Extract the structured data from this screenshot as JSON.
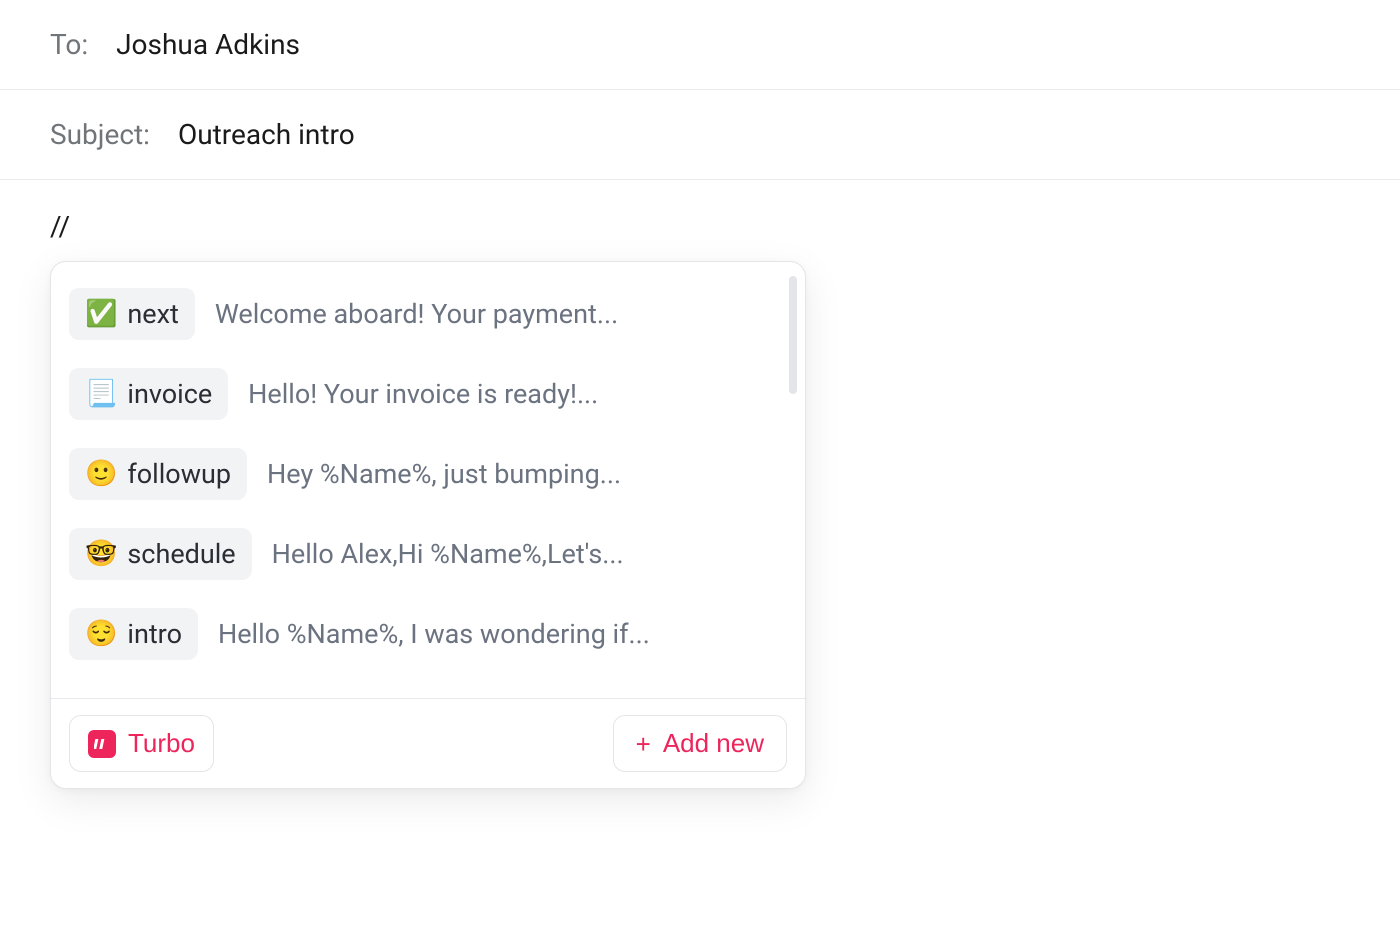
{
  "to": {
    "label": "To:",
    "value": "Joshua Adkins"
  },
  "subject": {
    "label": "Subject:",
    "value": "Outreach intro"
  },
  "body": {
    "trigger": "//"
  },
  "popup": {
    "snippets": [
      {
        "emoji": "✅",
        "name": "next",
        "preview": "Welcome aboard! Your payment..."
      },
      {
        "emoji": "📃",
        "name": "invoice",
        "preview": "Hello! Your invoice is ready!..."
      },
      {
        "emoji": "🙂",
        "name": "followup",
        "preview": "Hey %Name%, just bumping..."
      },
      {
        "emoji": "🤓",
        "name": "schedule",
        "preview": "Hello Alex,Hi %Name%,Let's..."
      },
      {
        "emoji": "😌",
        "name": "intro",
        "preview": "Hello %Name%, I was wondering if..."
      }
    ],
    "footer": {
      "turbo_label": "Turbo",
      "add_new_label": "Add new"
    }
  }
}
